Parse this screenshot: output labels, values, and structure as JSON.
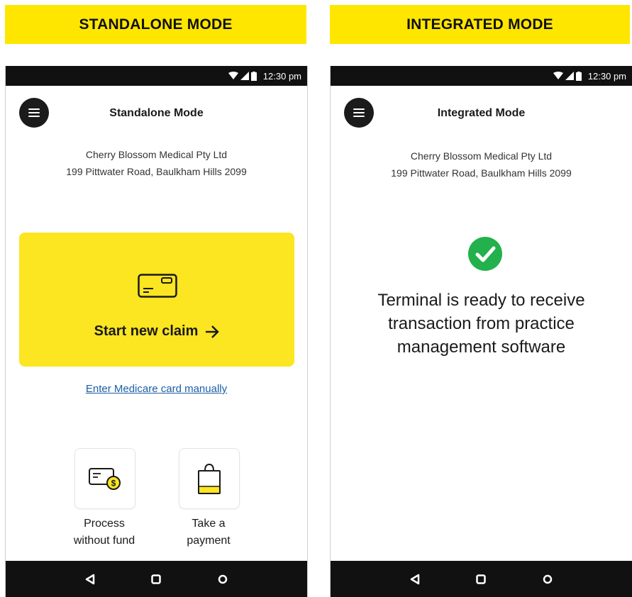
{
  "banners": {
    "left": "STANDALONE MODE",
    "right": "INTEGRATED MODE"
  },
  "status_bar": {
    "time": "12:30 pm"
  },
  "standalone": {
    "title": "Standalone Mode",
    "merchant_name": "Cherry Blossom Medical Pty Ltd",
    "merchant_address": "199 Pittwater Road, Baulkham Hills 2099",
    "start_claim_label": "Start new claim",
    "manual_entry_link": "Enter Medicare card manually",
    "tiles": [
      {
        "line1": "Process",
        "line2": "without fund",
        "icon": "card-coin-icon"
      },
      {
        "line1": "Take a",
        "line2": "payment",
        "icon": "shopping-bag-icon"
      }
    ]
  },
  "integrated": {
    "title": "Integrated Mode",
    "merchant_name": "Cherry Blossom Medical Pty Ltd",
    "merchant_address": "199 Pittwater Road, Baulkham Hills 2099",
    "ready_message": "Terminal is ready to receive transaction from practice management software"
  },
  "colors": {
    "accent_yellow": "#fce521",
    "banner_yellow": "#ffe600",
    "success_green": "#22b14c",
    "link_blue": "#1a5fa8",
    "bar_black": "#111111"
  }
}
